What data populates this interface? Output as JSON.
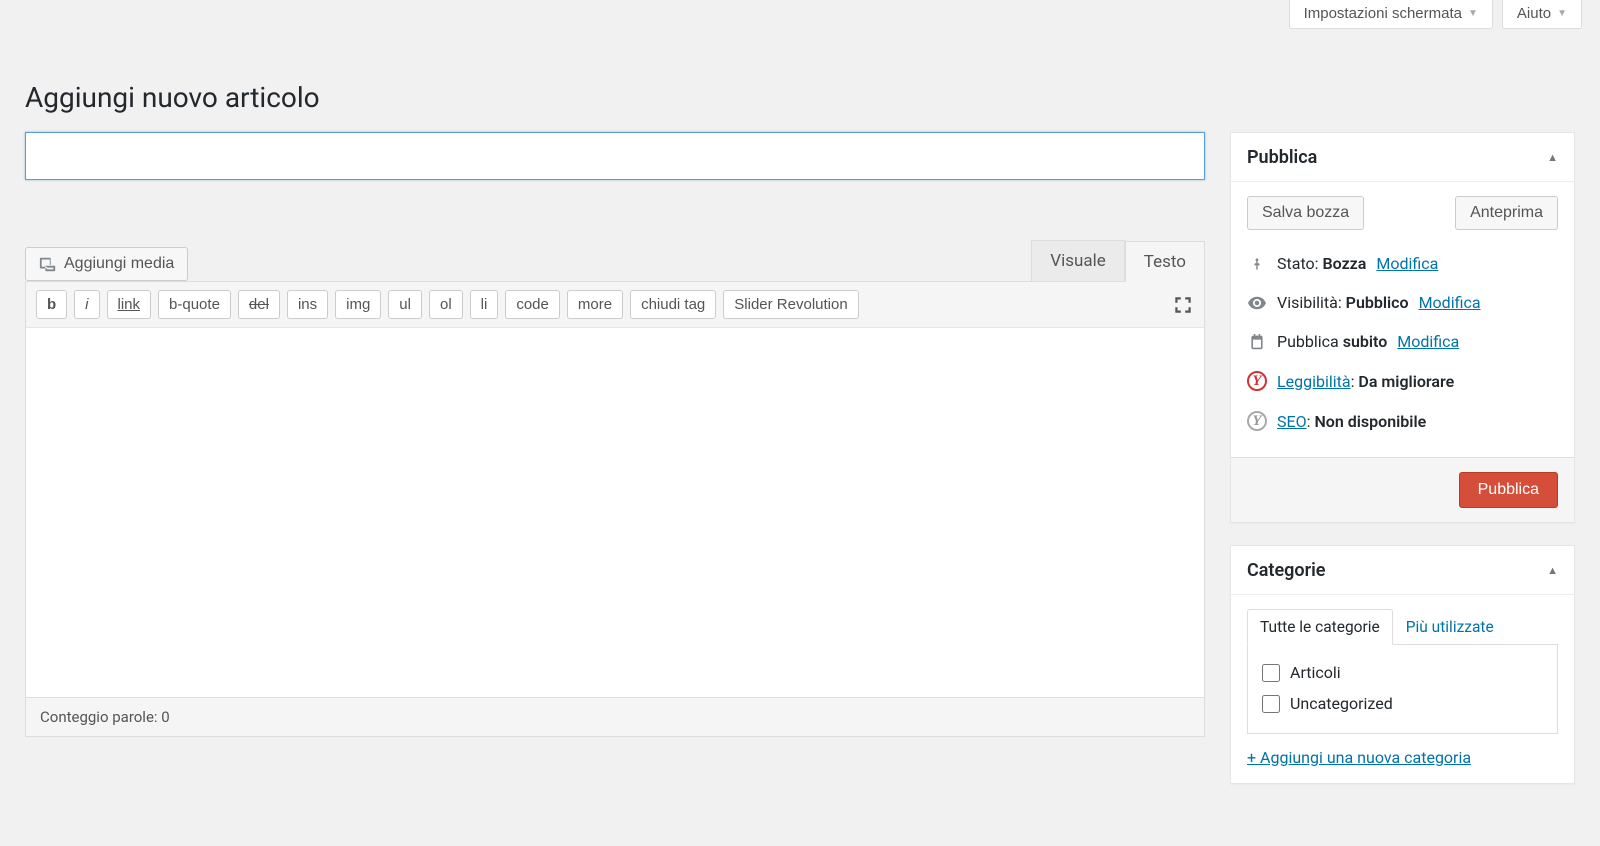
{
  "screenOptions": {
    "label": "Impostazioni schermata",
    "helpLabel": "Aiuto"
  },
  "pageTitle": "Aggiungi nuovo articolo",
  "titleField": {
    "value": ""
  },
  "mediaButton": "Aggiungi media",
  "editorTabs": {
    "visual": "Visuale",
    "text": "Testo"
  },
  "quicktags": {
    "b": "b",
    "i": "i",
    "link": "link",
    "bquote": "b-quote",
    "del": "del",
    "ins": "ins",
    "img": "img",
    "ul": "ul",
    "ol": "ol",
    "li": "li",
    "code": "code",
    "more": "more",
    "close": "chiudi tag",
    "slider": "Slider Revolution"
  },
  "wordCount": {
    "label": "Conteggio parole: ",
    "value": "0"
  },
  "publishBox": {
    "title": "Pubblica",
    "saveDraft": "Salva bozza",
    "preview": "Anteprima",
    "statusLabel": "Stato: ",
    "statusValue": "Bozza",
    "visibilityLabel": "Visibilità: ",
    "visibilityValue": "Pubblico",
    "scheduleLabel": "Pubblica ",
    "scheduleValue": "subito",
    "edit": "Modifica",
    "readabilityLabel": "Leggibilità",
    "readabilityValue": "Da migliorare",
    "seoLabel": "SEO",
    "seoValue": "Non disponibile",
    "publishBtn": "Pubblica"
  },
  "categoriesBox": {
    "title": "Categorie",
    "tabAll": "Tutte le categorie",
    "tabMost": "Più utilizzate",
    "items": [
      "Articoli",
      "Uncategorized"
    ],
    "addNew": "+ Aggiungi una nuova categoria"
  }
}
